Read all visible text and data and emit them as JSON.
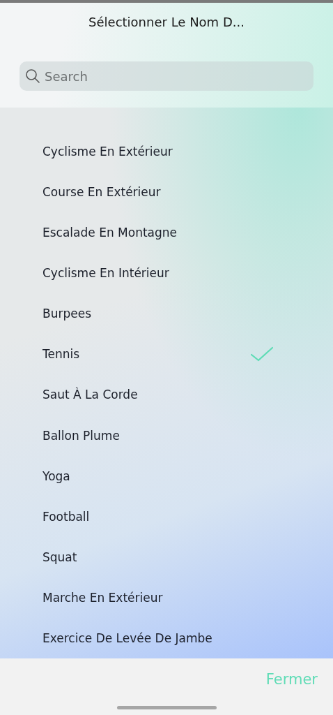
{
  "title": "Sélectionner Le Nom D...",
  "search": {
    "placeholder": "Search"
  },
  "items": [
    {
      "label": "Cyclisme En Extérieur",
      "selected": false
    },
    {
      "label": "Course En Extérieur",
      "selected": false
    },
    {
      "label": "Escalade En Montagne",
      "selected": false
    },
    {
      "label": "Cyclisme En Intérieur",
      "selected": false
    },
    {
      "label": "Burpees",
      "selected": false
    },
    {
      "label": "Tennis",
      "selected": true
    },
    {
      "label": "Saut À La Corde",
      "selected": false
    },
    {
      "label": "Ballon Plume",
      "selected": false
    },
    {
      "label": "Yoga",
      "selected": false
    },
    {
      "label": "Football",
      "selected": false
    },
    {
      "label": "Squat",
      "selected": false
    },
    {
      "label": "Marche En Extérieur",
      "selected": false
    },
    {
      "label": "Exercice De Levée De Jambe",
      "selected": false
    }
  ],
  "close_button": "Fermer"
}
